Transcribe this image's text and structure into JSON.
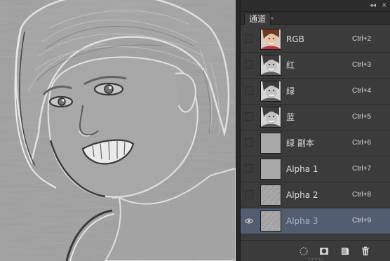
{
  "panel": {
    "tab_label": "通道",
    "tab_close": "×",
    "collapse_glyph": "◂◂",
    "close_glyph": "×"
  },
  "channels": [
    {
      "name": "RGB",
      "shortcut": "Ctrl+2",
      "visible": false,
      "selected": false,
      "thumb": "color-portrait"
    },
    {
      "name": "红",
      "shortcut": "Ctrl+3",
      "visible": false,
      "selected": false,
      "thumb": "gray-portrait"
    },
    {
      "name": "绿",
      "shortcut": "Ctrl+4",
      "visible": false,
      "selected": false,
      "thumb": "gray-portrait"
    },
    {
      "name": "蓝",
      "shortcut": "Ctrl+5",
      "visible": false,
      "selected": false,
      "thumb": "gray-portrait"
    },
    {
      "name": "绿 副本",
      "shortcut": "Ctrl+6",
      "visible": false,
      "selected": false,
      "thumb": "flat-gray"
    },
    {
      "name": "Alpha 1",
      "shortcut": "Ctrl+7",
      "visible": false,
      "selected": false,
      "thumb": "flat-gray"
    },
    {
      "name": "Alpha 2",
      "shortcut": "Ctrl+8",
      "visible": false,
      "selected": false,
      "thumb": "noise-gray"
    },
    {
      "name": "Alpha 3",
      "shortcut": "Ctrl+9",
      "visible": true,
      "selected": true,
      "thumb": "noise-gray"
    }
  ],
  "bottom_icons": [
    "selection-dotted-circle-icon",
    "save-mask-icon",
    "new-channel-icon",
    "trash-icon"
  ],
  "colors": {
    "panel_bg": "#3b3b3b",
    "selected_row": "#535d71",
    "canvas_gray": "#9c9c9c"
  }
}
